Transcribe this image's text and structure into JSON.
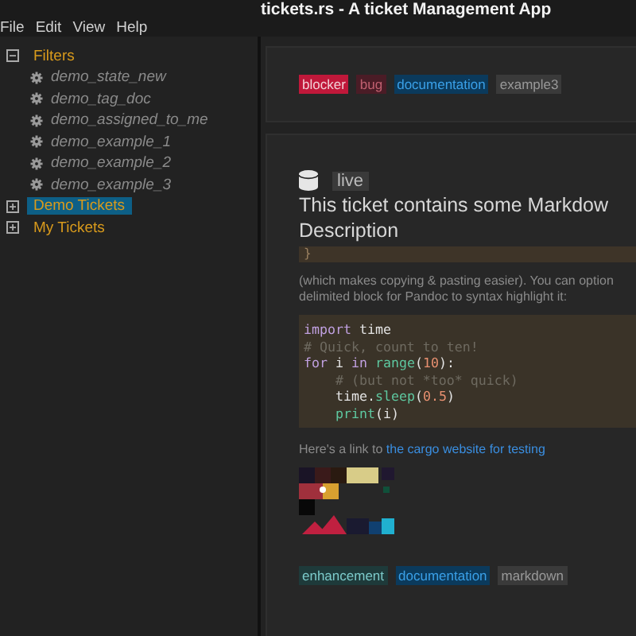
{
  "window": {
    "title": "tickets.rs - A ticket Management App"
  },
  "menu": [
    "File",
    "Edit",
    "View",
    "Help"
  ],
  "sidebar": {
    "groups": [
      {
        "label": "Filters",
        "expanded": true,
        "selected": false,
        "children": [
          {
            "label": "demo_state_new"
          },
          {
            "label": "demo_tag_doc"
          },
          {
            "label": "demo_assigned_to_me"
          },
          {
            "label": "demo_example_1"
          },
          {
            "label": "demo_example_2"
          },
          {
            "label": "demo_example_3"
          }
        ]
      },
      {
        "label": "Demo Tickets",
        "expanded": false,
        "selected": true
      },
      {
        "label": "My Tickets",
        "expanded": false,
        "selected": false
      }
    ]
  },
  "tickets": [
    {
      "tags": [
        {
          "label": "blocker",
          "color": "#c0183a"
        },
        {
          "label": "bug",
          "color": "#4a1c26"
        },
        {
          "label": "documentation",
          "color": "#0b3a5c"
        },
        {
          "label": "example3",
          "color": "#3a3a3a"
        }
      ]
    },
    {
      "state": "live",
      "title": "This ticket contains some Markdow",
      "title_line2": "Description",
      "brace": "}",
      "paragraph": [
        "(which makes copying & pasting easier). You can option",
        "delimited block for Pandoc to syntax highlight it:"
      ],
      "code": [
        [
          {
            "kind": "keyword",
            "text": "import"
          },
          {
            "kind": "plain",
            "text": " time"
          }
        ],
        [
          {
            "kind": "comment",
            "text": "# Quick, count to ten!"
          }
        ],
        [
          {
            "kind": "keyword",
            "text": "for"
          },
          {
            "kind": "plain",
            "text": " i "
          },
          {
            "kind": "keyword",
            "text": "in"
          },
          {
            "kind": "function",
            "text": " range"
          },
          {
            "kind": "plain",
            "text": "("
          },
          {
            "kind": "number",
            "text": "10"
          },
          {
            "kind": "plain",
            "text": "):"
          }
        ],
        [
          {
            "kind": "comment",
            "text": "    # (but not *too* quick)"
          }
        ],
        [
          {
            "kind": "plain",
            "text": "    time."
          },
          {
            "kind": "function",
            "text": "sleep"
          },
          {
            "kind": "plain",
            "text": "("
          },
          {
            "kind": "number",
            "text": "0.5"
          },
          {
            "kind": "plain",
            "text": ")"
          }
        ],
        [
          {
            "kind": "function",
            "text": "    print"
          },
          {
            "kind": "plain",
            "text": "(i)"
          }
        ]
      ],
      "link_prefix": "Here's a link to ",
      "link": "the cargo website for testing",
      "image": {
        "kind": "picture"
      },
      "tags": [
        {
          "label": "enhancement",
          "color": "#1e3a3a"
        },
        {
          "label": "documentation",
          "color": "#0b3a5c"
        },
        {
          "label": "markdown",
          "color": "#3a3a3a"
        }
      ]
    }
  ]
}
